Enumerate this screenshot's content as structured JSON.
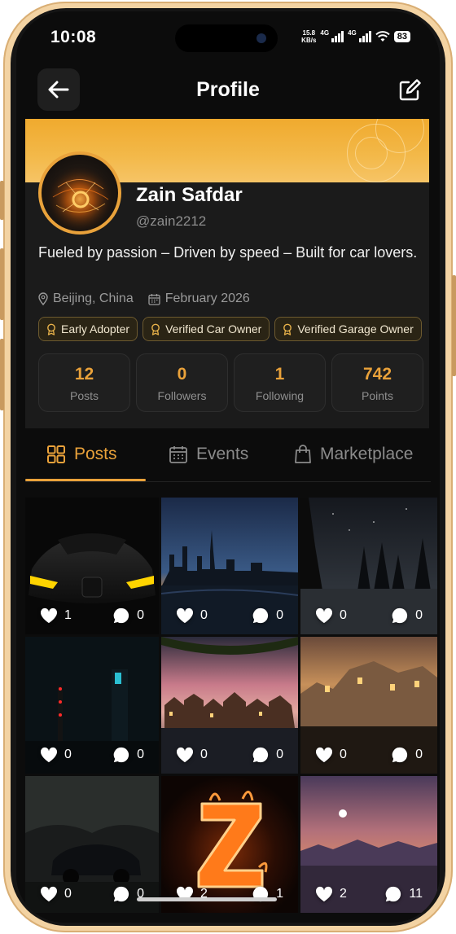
{
  "status_bar": {
    "time": "10:08",
    "net_speed_top": "15.8",
    "net_speed_bottom": "KB/s",
    "network_1": "4G",
    "network_2": "4G",
    "battery": "83"
  },
  "header": {
    "title": "Profile",
    "back_icon": "arrow-left-icon",
    "edit_icon": "edit-icon"
  },
  "profile": {
    "name": "Zain Safdar",
    "handle": "@zain2212",
    "bio": "Fueled by passion – Driven by speed – Built for car lovers.",
    "location": "Beijing, China",
    "joined": "February 2026",
    "badges": [
      {
        "label": "Early Adopter"
      },
      {
        "label": "Verified Car Owner"
      },
      {
        "label": "Verified Garage Owner"
      }
    ],
    "stats": [
      {
        "value": "12",
        "label": "Posts"
      },
      {
        "value": "0",
        "label": "Followers"
      },
      {
        "value": "1",
        "label": "Following"
      },
      {
        "value": "742",
        "label": "Points"
      }
    ]
  },
  "tabs": [
    {
      "label": "Posts",
      "icon": "grid-icon",
      "active": true
    },
    {
      "label": "Events",
      "icon": "calendar-icon",
      "active": false
    },
    {
      "label": "Marketplace",
      "icon": "shopping-bag-icon",
      "active": false
    }
  ],
  "posts": [
    {
      "likes": "1",
      "comments": "0"
    },
    {
      "likes": "0",
      "comments": "0"
    },
    {
      "likes": "0",
      "comments": "0"
    },
    {
      "likes": "0",
      "comments": "0"
    },
    {
      "likes": "0",
      "comments": "0"
    },
    {
      "likes": "0",
      "comments": "0"
    },
    {
      "likes": "0",
      "comments": "0"
    },
    {
      "likes": "2",
      "comments": "1"
    },
    {
      "likes": "2",
      "comments": "11"
    }
  ],
  "colors": {
    "accent": "#eaa23a",
    "background": "#0c0c0c",
    "card": "#1b1b1b"
  }
}
